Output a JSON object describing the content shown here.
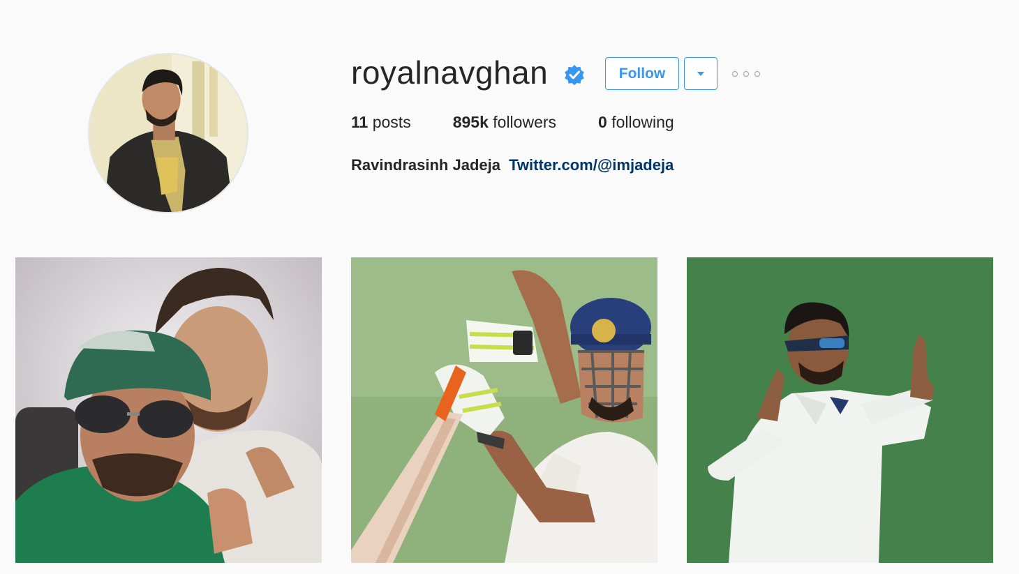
{
  "profile": {
    "username": "royalnavghan",
    "verified": true,
    "follow_label": "Follow",
    "dropdown_icon": "caret-down-icon",
    "more_icon": "ellipsis-icon",
    "accent_color": "#3897f0"
  },
  "stats": [
    {
      "value": "11",
      "label": "posts"
    },
    {
      "value": "895k",
      "label": "followers"
    },
    {
      "value": "0",
      "label": "following"
    }
  ],
  "bio": {
    "name": "Ravindrasinh Jadeja",
    "link": "Twitter.com/@imjadeja"
  },
  "posts": [
    {
      "icon": "selfie-photo"
    },
    {
      "icon": "batting-photo"
    },
    {
      "icon": "fielding-photo"
    }
  ]
}
